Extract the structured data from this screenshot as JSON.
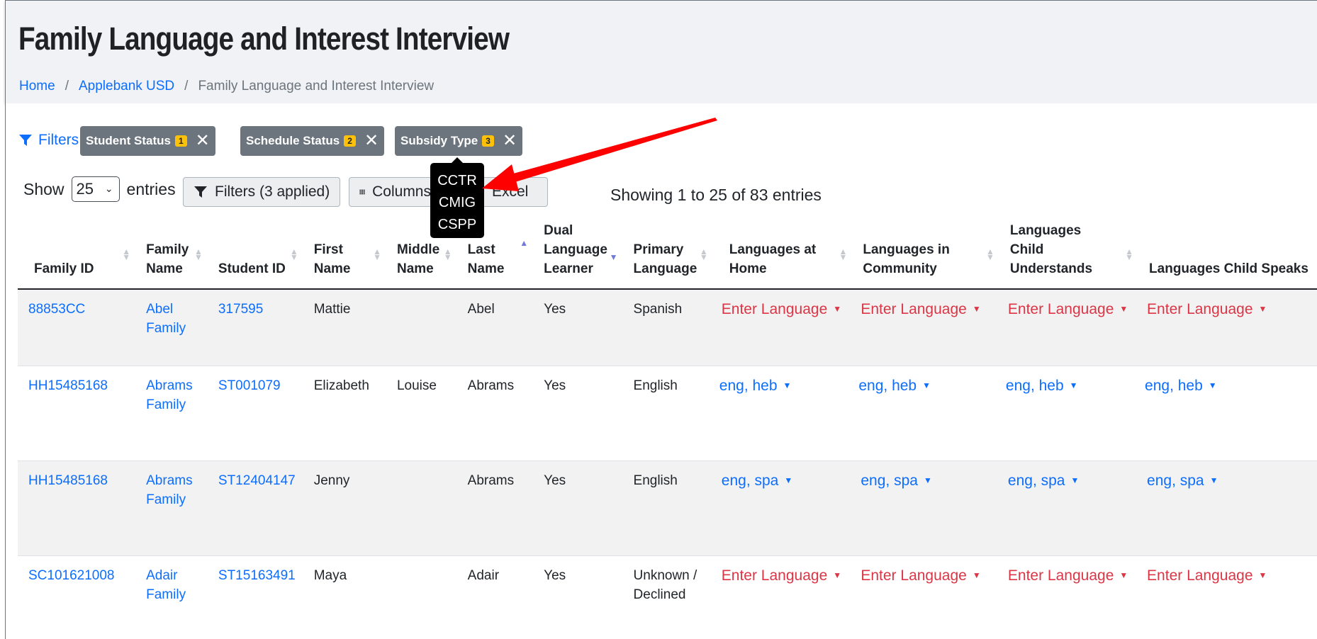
{
  "header": {
    "title": "Family Language and Interest Interview",
    "breadcrumb": [
      "Home",
      "Applebank USD",
      "Family Language and Interest Interview"
    ]
  },
  "filters": {
    "link_label": "Filters",
    "chips": [
      {
        "label": "Student Status",
        "count": "1"
      },
      {
        "label": "Schedule Status",
        "count": "2"
      },
      {
        "label": "Subsidy Type",
        "count": "3"
      }
    ],
    "tooltip_items": [
      "CCTR",
      "CMIG",
      "CSPP"
    ]
  },
  "toolbar": {
    "show_label": "Show",
    "entries_value": "25",
    "entries_label": "entries",
    "filters_button": "Filters (3 applied)",
    "columns_button": "Columns",
    "excel_button": "Excel",
    "showing_text": "Showing 1 to 25 of 83 entries"
  },
  "table": {
    "columns": [
      "Family ID",
      "Family Name",
      "Student ID",
      "First Name",
      "Middle Name",
      "Last Name",
      "Dual Language Learner",
      "Primary Language",
      "Languages at Home",
      "Languages in Community",
      "Languages Child Understands",
      "Languages Child Speaks"
    ],
    "rows": [
      {
        "family_id": "88853CC",
        "family_name": "Abel Family",
        "student_id": "317595",
        "first": "Mattie",
        "middle": "",
        "last": "Abel",
        "dll": "Yes",
        "primary": "Spanish",
        "home": "Enter Language",
        "community": "Enter Language",
        "understands": "Enter Language",
        "speaks": "Enter Language"
      },
      {
        "family_id": "HH15485168",
        "family_name": "Abrams Family",
        "student_id": "ST001079",
        "first": "Elizabeth",
        "middle": "Louise",
        "last": "Abrams",
        "dll": "Yes",
        "primary": "English",
        "home": "eng, heb",
        "community": "eng, heb",
        "understands": "eng, heb",
        "speaks": "eng, heb"
      },
      {
        "family_id": "HH15485168",
        "family_name": "Abrams Family",
        "student_id": "ST12404147",
        "first": "Jenny",
        "middle": "",
        "last": "Abrams",
        "dll": "Yes",
        "primary": "English",
        "home": "eng, spa",
        "community": "eng, spa",
        "understands": "eng, spa",
        "speaks": "eng, spa"
      },
      {
        "family_id": "SC101621008",
        "family_name": "Adair Family",
        "student_id": "ST15163491",
        "first": "Maya",
        "middle": "",
        "last": "Adair",
        "dll": "Yes",
        "primary": "Unknown / Declined",
        "home": "Enter Language",
        "community": "Enter Language",
        "understands": "Enter Language",
        "speaks": "Enter Language"
      }
    ]
  }
}
